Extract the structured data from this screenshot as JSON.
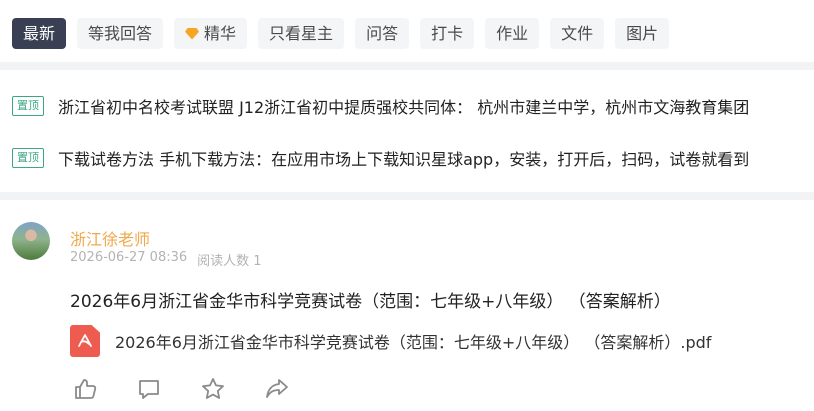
{
  "tabs": [
    {
      "label": "最新",
      "active": true
    },
    {
      "label": "等我回答"
    },
    {
      "label": "精华",
      "icon": "diamond-icon"
    },
    {
      "label": "只看星主"
    },
    {
      "label": "问答"
    },
    {
      "label": "打卡"
    },
    {
      "label": "作业"
    },
    {
      "label": "文件"
    },
    {
      "label": "图片"
    }
  ],
  "pinned": {
    "badge": "置顶",
    "items": [
      {
        "text": "浙江省初中名校考试联盟 J12浙江省初中提质强校共同体： 杭州市建兰中学，杭州市文海教育集团"
      },
      {
        "text": "下载试卷方法 手机下载方法：在应用市场上下载知识星球app，安装，打开后，扫码，试卷就看到"
      }
    ]
  },
  "post": {
    "author": "浙江徐老师",
    "time": "2026-06-27 08:36",
    "reads": "阅读人数 1",
    "title": "2026年6月浙江省金华市科学竞赛试卷（范围：七年级+八年级）  （答案解析）",
    "file": {
      "name": "2026年6月浙江省金华市科学竞赛试卷（范围：七年级+八年级）  （答案解析）.pdf",
      "icon": "pdf-icon"
    },
    "actions": [
      "like-icon",
      "comment-icon",
      "star-icon",
      "share-icon"
    ]
  },
  "colors": {
    "accent_tab": "#3a4054",
    "pin_green": "#3aa981",
    "author_orange": "#f0a94a",
    "pdf_red": "#ee5b4f"
  }
}
